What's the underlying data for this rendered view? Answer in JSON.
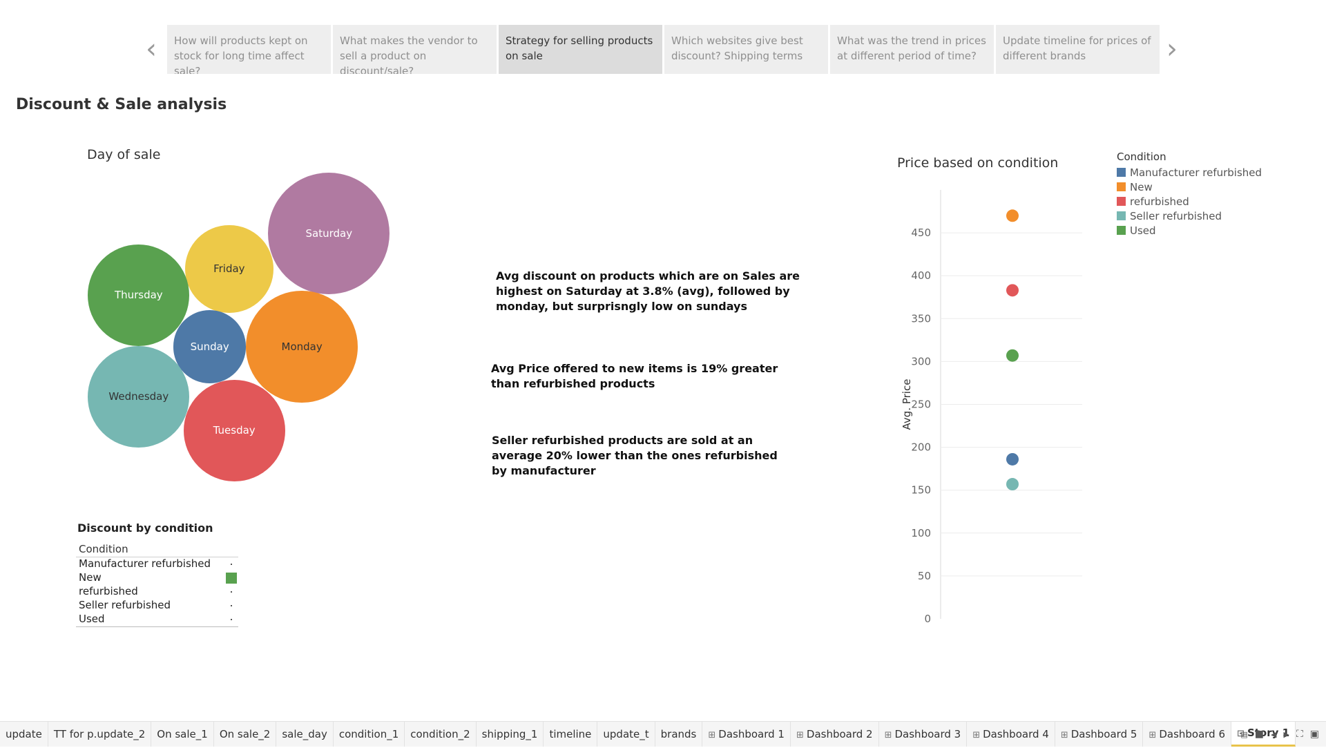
{
  "story_nav": {
    "prev_icon": "chevron-left-icon",
    "next_icon": "chevron-right-icon",
    "points": [
      {
        "label": "How will products kept on stock for long time affect sale?"
      },
      {
        "label": "What makes the vendor to sell a product on discount/sale?"
      },
      {
        "label": "Strategy for selling products on sale",
        "active": true
      },
      {
        "label": "Which websites give best discount? Shipping terms"
      },
      {
        "label": "What was the trend in prices at different period of time?"
      },
      {
        "label": "Update timeline for prices of different brands"
      }
    ]
  },
  "page_title": "Discount & Sale analysis",
  "day_of_sale": {
    "title": "Day of sale",
    "bubbles": [
      {
        "day": "Saturday",
        "color": "#b07aa1",
        "text_color": "#ffffff"
      },
      {
        "day": "Friday",
        "color": "#edc948",
        "text_color": "#333333"
      },
      {
        "day": "Thursday",
        "color": "#59a14f",
        "text_color": "#ffffff"
      },
      {
        "day": "Sunday",
        "color": "#4e79a7",
        "text_color": "#ffffff"
      },
      {
        "day": "Monday",
        "color": "#f28e2b",
        "text_color": "#333333"
      },
      {
        "day": "Wednesday",
        "color": "#76b7b2",
        "text_color": "#333333"
      },
      {
        "day": "Tuesday",
        "color": "#e15759",
        "text_color": "#ffffff"
      }
    ]
  },
  "insights": [
    "Avg discount on products which are on Sales are highest on Saturday at 3.8% (avg), followed by monday, but surprisngly low on sundays",
    "Avg Price offered to new items is 19% greater than refurbished products",
    "Seller refurbished products are sold at an average 20% lower than the ones refurbished by manufacturer"
  ],
  "discount_by_condition": {
    "title": "Discount by condition",
    "header": "Condition",
    "rows": [
      {
        "condition": "Manufacturer refurbished",
        "mark": "dot"
      },
      {
        "condition": "New",
        "mark": "square"
      },
      {
        "condition": "refurbished",
        "mark": "dot"
      },
      {
        "condition": "Seller refurbished",
        "mark": "dot"
      },
      {
        "condition": "Used",
        "mark": "dot"
      }
    ]
  },
  "price_chart": {
    "title": "Price based on condition",
    "legend_title": "Condition",
    "legend": [
      {
        "name": "Manufacturer refurbished",
        "color": "#4e79a7"
      },
      {
        "name": "New",
        "color": "#f28e2b"
      },
      {
        "name": "refurbished",
        "color": "#e15759"
      },
      {
        "name": "Seller refurbished",
        "color": "#76b7b2"
      },
      {
        "name": "Used",
        "color": "#59a14f"
      }
    ]
  },
  "chart_data": {
    "type": "scatter",
    "title": "Price based on condition",
    "xlabel": "",
    "ylabel": "Avg. Price",
    "ylim": [
      0,
      500
    ],
    "yticks": [
      0,
      50,
      100,
      150,
      200,
      250,
      300,
      350,
      400,
      450
    ],
    "grid": true,
    "legend_position": "right",
    "series": [
      {
        "name": "New",
        "color": "#f28e2b",
        "values": [
          470
        ]
      },
      {
        "name": "refurbished",
        "color": "#e15759",
        "values": [
          383
        ]
      },
      {
        "name": "Used",
        "color": "#59a14f",
        "values": [
          307
        ]
      },
      {
        "name": "Manufacturer refurbished",
        "color": "#4e79a7",
        "values": [
          186
        ]
      },
      {
        "name": "Seller refurbished",
        "color": "#76b7b2",
        "values": [
          157
        ]
      }
    ]
  },
  "tabs": [
    {
      "label": "update"
    },
    {
      "label": "TT for p.update_2"
    },
    {
      "label": "On sale_1"
    },
    {
      "label": "On sale_2"
    },
    {
      "label": "sale_day"
    },
    {
      "label": "condition_1"
    },
    {
      "label": "condition_2"
    },
    {
      "label": "shipping_1"
    },
    {
      "label": "timeline"
    },
    {
      "label": "update_t"
    },
    {
      "label": "brands"
    },
    {
      "label": "Dashboard 1",
      "icon": "⊞"
    },
    {
      "label": "Dashboard 2",
      "icon": "⊞"
    },
    {
      "label": "Dashboard 3",
      "icon": "⊞"
    },
    {
      "label": "Dashboard 4",
      "icon": "⊞"
    },
    {
      "label": "Dashboard 5",
      "icon": "⊞"
    },
    {
      "label": "Dashboard 6",
      "icon": "⊞"
    },
    {
      "label": "Story 1",
      "icon": "⊡",
      "active": true
    }
  ],
  "tab_controls": [
    "show-filmstrip-icon",
    "show-tabs-icon",
    "prev-sheet-icon",
    "next-sheet-icon",
    "fullscreen-icon",
    "present-icon"
  ]
}
